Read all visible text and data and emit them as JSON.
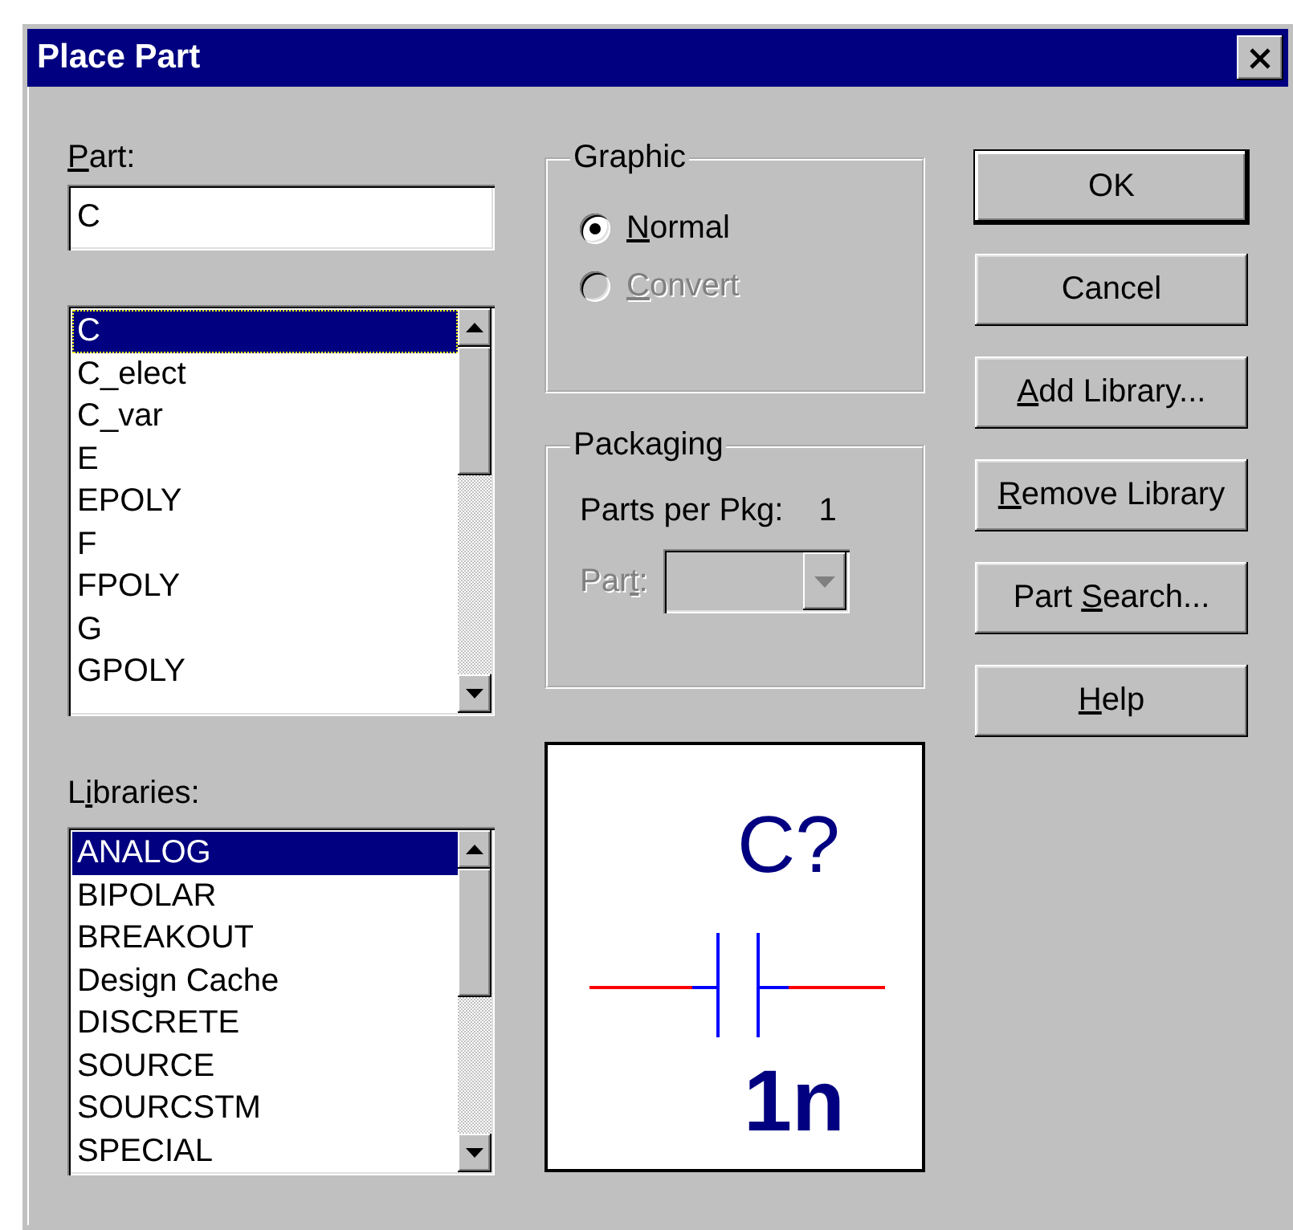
{
  "window": {
    "title": "Place Part"
  },
  "part_field": {
    "label": {
      "key": "P",
      "post": "art:"
    },
    "value": "C"
  },
  "part_list": {
    "items": [
      {
        "label": "C",
        "selected": true
      },
      {
        "label": "C_elect",
        "selected": false
      },
      {
        "label": "C_var",
        "selected": false
      },
      {
        "label": "E",
        "selected": false
      },
      {
        "label": "EPOLY",
        "selected": false
      },
      {
        "label": "F",
        "selected": false
      },
      {
        "label": "FPOLY",
        "selected": false
      },
      {
        "label": "G",
        "selected": false
      },
      {
        "label": "GPOLY",
        "selected": false
      }
    ]
  },
  "libraries": {
    "label": {
      "pre": "L",
      "key": "i",
      "post": "braries:"
    },
    "items": [
      {
        "label": "ANALOG",
        "selected": true
      },
      {
        "label": "BIPOLAR",
        "selected": false
      },
      {
        "label": "BREAKOUT",
        "selected": false
      },
      {
        "label": "Design Cache",
        "selected": false
      },
      {
        "label": "DISCRETE",
        "selected": false
      },
      {
        "label": "SOURCE",
        "selected": false
      },
      {
        "label": "SOURCSTM",
        "selected": false
      },
      {
        "label": "SPECIAL",
        "selected": false
      }
    ]
  },
  "graphic": {
    "title": "Graphic",
    "options": [
      {
        "label": {
          "key": "N",
          "post": "ormal"
        },
        "selected": true,
        "disabled": false
      },
      {
        "label": {
          "key": "C",
          "post": "onvert"
        },
        "selected": false,
        "disabled": true
      }
    ]
  },
  "packaging": {
    "title": "Packaging",
    "parts_per_pkg_label": "Parts per Pkg:",
    "parts_per_pkg_value": "1",
    "part_select": {
      "label": {
        "pre": "Par",
        "key": "t",
        "post": ":"
      },
      "disabled": true
    }
  },
  "preview": {
    "reference": "C?",
    "value": "1n"
  },
  "buttons": [
    {
      "label": {
        "post": "OK"
      },
      "default": true
    },
    {
      "label": {
        "post": "Cancel"
      },
      "default": false
    },
    {
      "label": {
        "key": "A",
        "post": "dd Library..."
      },
      "default": false
    },
    {
      "label": {
        "key": "R",
        "post": "emove Library"
      },
      "default": false
    },
    {
      "label": {
        "pre": "Part ",
        "key": "S",
        "post": "earch..."
      },
      "default": false
    },
    {
      "label": {
        "key": "H",
        "post": "elp"
      },
      "default": false
    }
  ]
}
